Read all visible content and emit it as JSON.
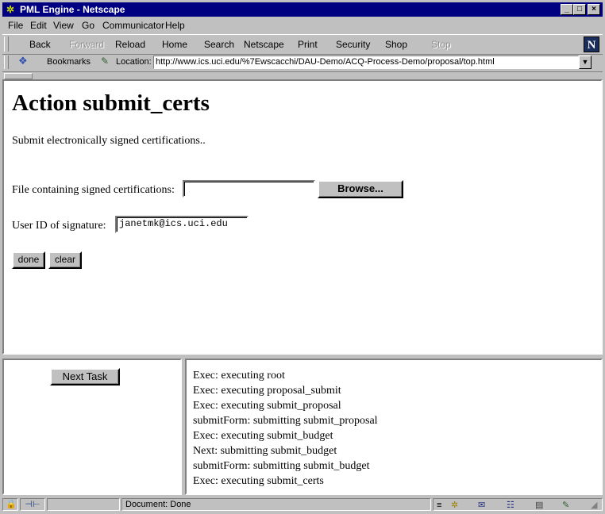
{
  "window": {
    "title": "PML Engine - Netscape",
    "app_icon": "netscape-app-icon",
    "controls": {
      "minimize": "_",
      "maximize": "□",
      "close": "×"
    }
  },
  "menu": [
    "File",
    "Edit",
    "View",
    "Go",
    "Communicator",
    "Help"
  ],
  "toolbar": {
    "items": [
      {
        "label": "Back",
        "enabled": true
      },
      {
        "label": "Forward",
        "enabled": false
      },
      {
        "label": "Reload",
        "enabled": true
      },
      {
        "label": "Home",
        "enabled": true
      },
      {
        "label": "Search",
        "enabled": true
      },
      {
        "label": "Netscape",
        "enabled": true
      },
      {
        "label": "Print",
        "enabled": true
      },
      {
        "label": "Security",
        "enabled": true
      },
      {
        "label": "Shop",
        "enabled": true
      },
      {
        "label": "Stop",
        "enabled": false
      }
    ],
    "logo": "N"
  },
  "location": {
    "bookmarks_label": "Bookmarks",
    "location_label": "Location:",
    "url": "http://www.ics.uci.edu/%7Ewscacchi/DAU-Demo/ACQ-Process-Demo/proposal/top.html"
  },
  "top_frame": {
    "heading": "Action submit_certs",
    "description": "Submit electronically signed certifications..",
    "file_label": "File containing signed certifications:",
    "file_value": "",
    "browse_label": "Browse...",
    "userid_label": "User ID of signature:",
    "userid_value": "janetmk@ics.uci.edu",
    "done_label": "done",
    "clear_label": "clear"
  },
  "left_frame": {
    "next_task_label": "Next Task"
  },
  "log": [
    "Exec: executing root",
    "Exec: executing proposal_submit",
    "Exec: executing submit_proposal",
    "submitForm: submitting submit_proposal",
    "Exec: executing submit_budget",
    "Next: submitting submit_budget",
    "submitForm: submitting submit_budget",
    "Exec: executing submit_certs"
  ],
  "status": {
    "text": "Document: Done",
    "colors": {
      "title_bar": "#000080",
      "chrome": "#c0c0c0"
    }
  }
}
